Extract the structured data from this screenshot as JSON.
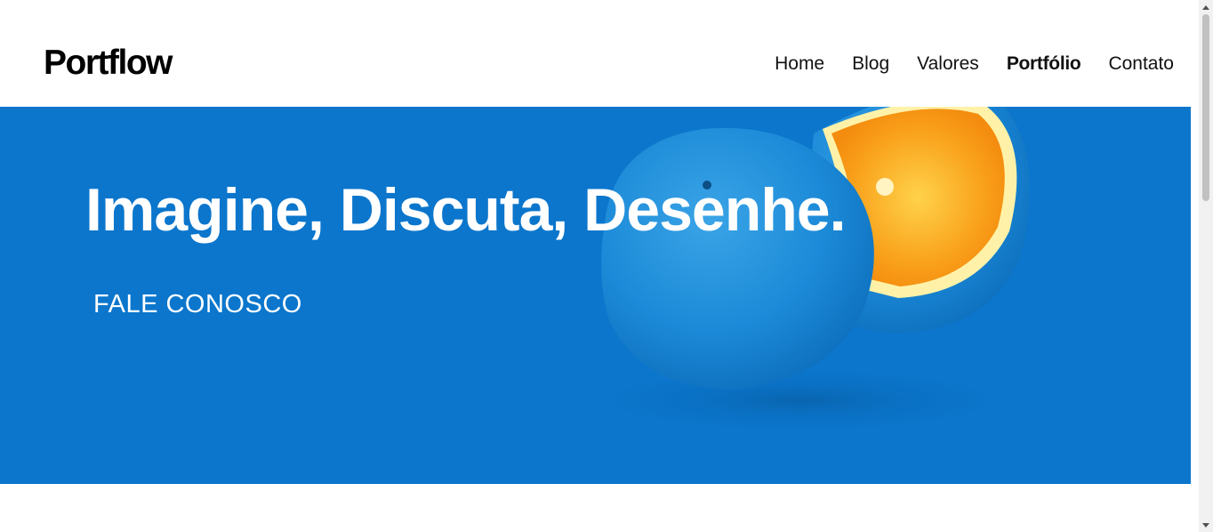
{
  "brand": {
    "logo": "Portflow"
  },
  "nav": {
    "items": [
      {
        "label": "Home",
        "active": false
      },
      {
        "label": "Blog",
        "active": false
      },
      {
        "label": "Valores",
        "active": false
      },
      {
        "label": "Portfólio",
        "active": true
      },
      {
        "label": "Contato",
        "active": false
      }
    ]
  },
  "hero": {
    "headline": "Imagine, Discuta, Desenhe.",
    "cta_label": "FALE CONOSCO",
    "background_color": "#0b76cc",
    "image_icon": "orange-halves-image"
  },
  "colors": {
    "accent_orange": "#f7a21b",
    "hero_blue": "#0b76cc"
  }
}
